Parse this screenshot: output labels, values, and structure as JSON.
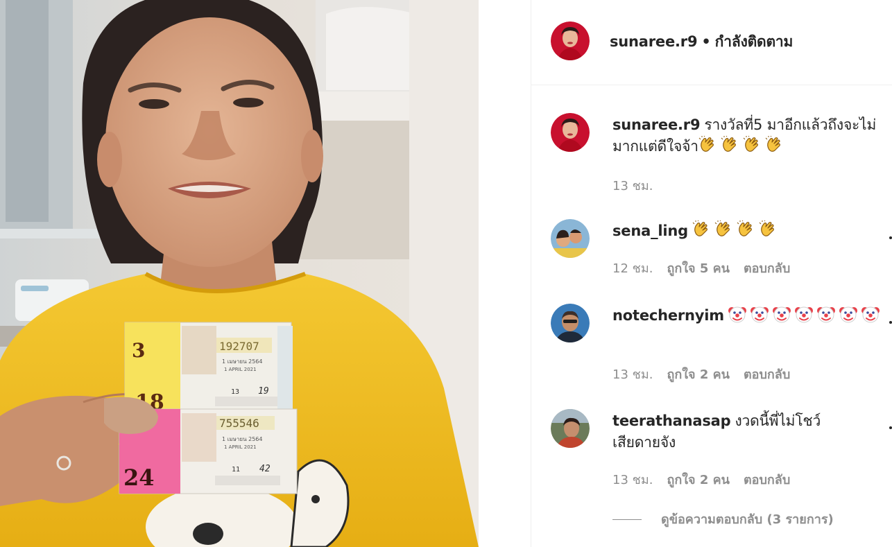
{
  "post": {
    "author": "sunaree.r9",
    "follow_dot": "•",
    "follow_status": "กำลังติดตาม"
  },
  "caption": {
    "username": "sunaree.r9",
    "text": "รางวัลที่5 มาอีกแล้วถึงจะไม่มากแต่ดีใจจ้า",
    "emoji": [
      "clap-icon",
      "clap-icon",
      "clap-icon",
      "clap-icon"
    ],
    "time": "13 ชม."
  },
  "comments": [
    {
      "username": "sena_ling",
      "text": "",
      "emoji": [
        "clap-icon",
        "clap-icon",
        "clap-icon",
        "clap-icon"
      ],
      "time": "12 ชม.",
      "likes": "ถูกใจ 5 คน",
      "reply": "ตอบกลับ"
    },
    {
      "username": "notechernyim",
      "text": "",
      "emoji": [
        "clown-icon",
        "clown-icon",
        "clown-icon",
        "clown-icon",
        "clown-icon",
        "clown-icon",
        "clown-icon"
      ],
      "time": "13 ชม.",
      "likes": "ถูกใจ 2 คน",
      "reply": "ตอบกลับ"
    },
    {
      "username": "teerathanasap",
      "text_line1": "งวดนี้พี่ไม่โชว์",
      "text_line2": "เสียดายจัง",
      "time": "13 ชม.",
      "likes": "ถูกใจ 2 คน",
      "reply": "ตอบกลับ",
      "view_replies": "ดูข้อความตอบกลับ (3 รายการ)"
    }
  ],
  "ticket": {
    "top_number": "192707",
    "bottom_number": "755546",
    "top_set": "18",
    "bottom_set": "24",
    "top_draw": "3",
    "top_small": "19",
    "bottom_small": "42",
    "top_count": "13",
    "bottom_count": "11",
    "date_th": "1 เมษายน 2564",
    "date_en": "1 APRIL 2021"
  },
  "colors": {
    "accent_text": "#262626",
    "muted_text": "#8e8e8e",
    "divider": "#efefef",
    "shirt_yellow": "#f2c21b",
    "ticket_pink": "#f06aa0",
    "ticket_yellow": "#f7e25c"
  }
}
